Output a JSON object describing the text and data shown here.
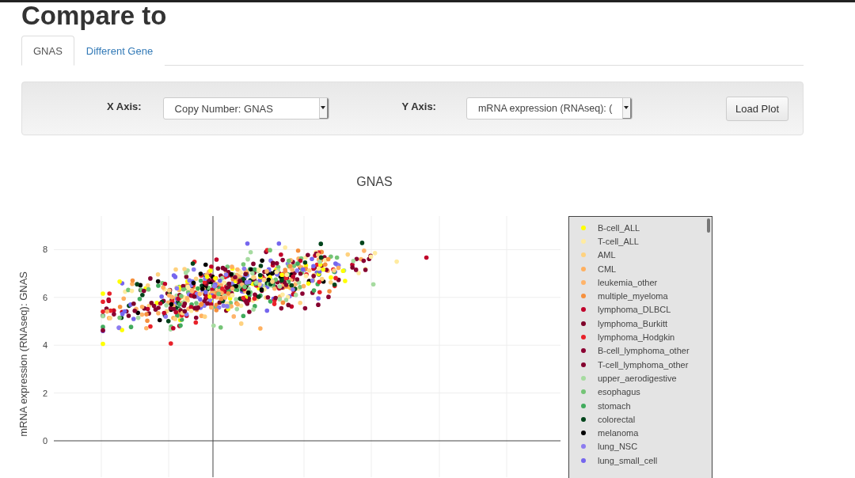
{
  "heading": "Compare to",
  "tabs": [
    {
      "label": "GNAS",
      "selected": true
    },
    {
      "label": "Different Gene",
      "selected": false
    }
  ],
  "controls": {
    "x_axis": {
      "label": "X Axis:",
      "value": "Copy Number: GNAS"
    },
    "y_axis": {
      "label": "Y Axis:",
      "value": "mRNA expression (RNAseq): ("
    },
    "load_button": "Load Plot"
  },
  "plot": {
    "title": "GNAS",
    "ylabel": "mRNA expression (RNAseq): GNAS",
    "yticks": [
      "8",
      "6",
      "4",
      "2",
      "0"
    ],
    "legend": [
      {
        "label": "B-cell_ALL",
        "color": "#ffff00"
      },
      {
        "label": "T-cell_ALL",
        "color": "#ffeba0"
      },
      {
        "label": "AML",
        "color": "#ffd27f"
      },
      {
        "label": "CML",
        "color": "#ffb060"
      },
      {
        "label": "leukemia_other",
        "color": "#ffb46a"
      },
      {
        "label": "multiple_myeloma",
        "color": "#f6903d"
      },
      {
        "label": "lymphoma_DLBCL",
        "color": "#c0002a"
      },
      {
        "label": "lymphoma_Burkitt",
        "color": "#7f0029"
      },
      {
        "label": "lymphoma_Hodgkin",
        "color": "#e8212a"
      },
      {
        "label": "B-cell_lymphoma_other",
        "color": "#8b0032"
      },
      {
        "label": "T-cell_lymphoma_other",
        "color": "#84002e"
      },
      {
        "label": "upper_aerodigestive",
        "color": "#a6dba0"
      },
      {
        "label": "esophagus",
        "color": "#74c476"
      },
      {
        "label": "stomach",
        "color": "#41ab5d"
      },
      {
        "label": "colorectal",
        "color": "#00441b"
      },
      {
        "label": "melanoma",
        "color": "#000000"
      },
      {
        "label": "lung_NSC",
        "color": "#8c7cf0"
      },
      {
        "label": "lung_small_cell",
        "color": "#7566ee"
      }
    ]
  }
}
